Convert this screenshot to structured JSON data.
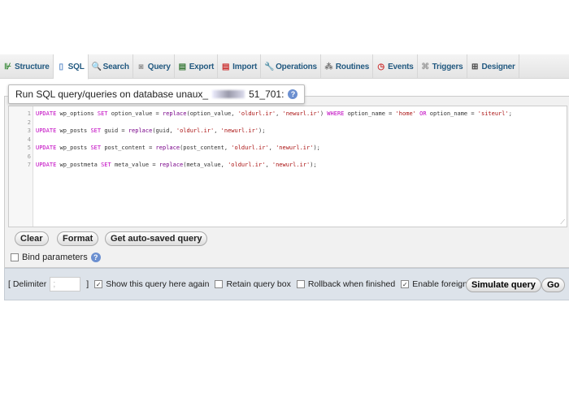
{
  "tabs": [
    {
      "label": "Structure",
      "icon": "structure-icon",
      "glyph": "⊮",
      "color": "#3a8a3a"
    },
    {
      "label": "SQL",
      "icon": "sql-icon",
      "glyph": "▯",
      "color": "#5a8ac8",
      "active": true
    },
    {
      "label": "Search",
      "icon": "search-icon",
      "glyph": "🔍",
      "color": "#5a8ac8"
    },
    {
      "label": "Query",
      "icon": "query-icon",
      "glyph": "◙",
      "color": "#999"
    },
    {
      "label": "Export",
      "icon": "export-icon",
      "glyph": "▤",
      "color": "#3a7a3a"
    },
    {
      "label": "Import",
      "icon": "import-icon",
      "glyph": "▤",
      "color": "#c33"
    },
    {
      "label": "Operations",
      "icon": "wrench-icon",
      "glyph": "🔧",
      "color": "#5a8ac8"
    },
    {
      "label": "Routines",
      "icon": "routines-icon",
      "glyph": "⁂",
      "color": "#777"
    },
    {
      "label": "Events",
      "icon": "clock-icon",
      "glyph": "◷",
      "color": "#c33"
    },
    {
      "label": "Triggers",
      "icon": "triggers-icon",
      "glyph": "⌘",
      "color": "#999"
    },
    {
      "label": "Designer",
      "icon": "designer-icon",
      "glyph": "⊞",
      "color": "#444"
    }
  ],
  "legend": {
    "prefix": "Run SQL query/queries on database unaux_",
    "suffix": "51_701:"
  },
  "editor": {
    "lines": [
      {
        "n": "1",
        "tokens": [
          [
            "k",
            "UPDATE"
          ],
          [
            "p",
            " wp_options "
          ],
          [
            "k",
            "SET"
          ],
          [
            "p",
            " option_value = "
          ],
          [
            "f",
            "replace"
          ],
          [
            "p",
            "(option_value, "
          ],
          [
            "s",
            "'oldurl.ir'"
          ],
          [
            "p",
            ", "
          ],
          [
            "s",
            "'newurl.ir'"
          ],
          [
            "p",
            ") "
          ],
          [
            "k",
            "WHERE"
          ],
          [
            "p",
            " option_name = "
          ],
          [
            "s",
            "'home'"
          ],
          [
            "p",
            " "
          ],
          [
            "k",
            "OR"
          ],
          [
            "p",
            " option_name = "
          ],
          [
            "s",
            "'siteurl'"
          ],
          [
            "p",
            ";"
          ]
        ]
      },
      {
        "n": "2",
        "tokens": []
      },
      {
        "n": "3",
        "tokens": [
          [
            "k",
            "UPDATE"
          ],
          [
            "p",
            " wp_posts "
          ],
          [
            "k",
            "SET"
          ],
          [
            "p",
            " guid = "
          ],
          [
            "f",
            "replace"
          ],
          [
            "p",
            "(guid, "
          ],
          [
            "s",
            "'oldurl.ir'"
          ],
          [
            "p",
            ", "
          ],
          [
            "s",
            "'newurl.ir'"
          ],
          [
            "p",
            ");"
          ]
        ]
      },
      {
        "n": "4",
        "tokens": []
      },
      {
        "n": "5",
        "tokens": [
          [
            "k",
            "UPDATE"
          ],
          [
            "p",
            " wp_posts "
          ],
          [
            "k",
            "SET"
          ],
          [
            "p",
            " post_content = "
          ],
          [
            "f",
            "replace"
          ],
          [
            "p",
            "(post_content, "
          ],
          [
            "s",
            "'oldurl.ir'"
          ],
          [
            "p",
            ", "
          ],
          [
            "s",
            "'newurl.ir'"
          ],
          [
            "p",
            ");"
          ]
        ]
      },
      {
        "n": "6",
        "tokens": []
      },
      {
        "n": "7",
        "tokens": [
          [
            "k",
            "UPDATE"
          ],
          [
            "p",
            " wp_postmeta "
          ],
          [
            "k",
            "SET"
          ],
          [
            "p",
            " meta_value = "
          ],
          [
            "f",
            "replace"
          ],
          [
            "p",
            "(meta_value, "
          ],
          [
            "s",
            "'oldurl.ir'"
          ],
          [
            "p",
            ", "
          ],
          [
            "s",
            "'newurl.ir'"
          ],
          [
            "p",
            ");"
          ]
        ]
      }
    ]
  },
  "buttons": {
    "clear": "Clear",
    "format": "Format",
    "autosaved": "Get auto-saved query"
  },
  "bind_parameters": {
    "label": "Bind parameters",
    "checked": false
  },
  "footer": {
    "delimiter_open": "[ Delimiter",
    "delimiter_value": ";",
    "delimiter_close": "]",
    "show_query": {
      "label": "Show this query here again",
      "checked": true
    },
    "retain": {
      "label": "Retain query box",
      "checked": false
    },
    "rollback": {
      "label": "Rollback when finished",
      "checked": false
    },
    "fk": {
      "label": "Enable foreign key checks",
      "checked": true
    },
    "simulate": "Simulate query",
    "go": "Go"
  }
}
